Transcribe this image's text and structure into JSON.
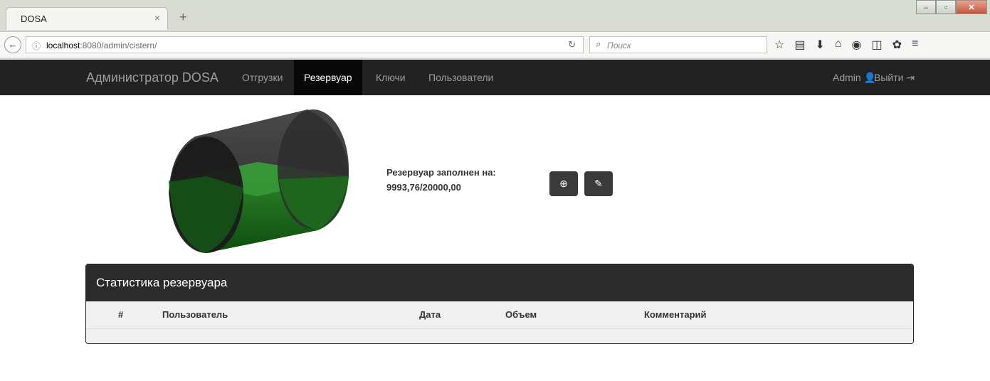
{
  "browser": {
    "tab_title": "DOSA",
    "tab_close": "×",
    "new_tab": "+",
    "url_host": "localhost",
    "url_rest": ":8080/admin/cistern/",
    "search_placeholder": "Поиск",
    "icons": [
      "star-icon",
      "reading-list-icon",
      "download-icon",
      "home-icon",
      "chat-icon",
      "pocket-icon",
      "extension-icon",
      "menu-icon"
    ]
  },
  "nav": {
    "brand": "Администратор DOSA",
    "items": [
      {
        "label": "Отгрузки",
        "active": false
      },
      {
        "label": "Резервуар",
        "active": true
      },
      {
        "label": "Ключи",
        "active": false
      },
      {
        "label": "Пользователи",
        "active": false
      }
    ],
    "user": "Admin",
    "logout": "Выйти"
  },
  "cistern": {
    "fill_label": "Резервуар заполнен на:",
    "fill_value": "9993,76/20000,00",
    "fill_fraction": 0.4997,
    "colors": {
      "liquid": "#1f6b1f",
      "tank": "#2a2a2a"
    }
  },
  "stats": {
    "title": "Статистика резервуара",
    "columns": [
      "#",
      "Пользователь",
      "Дата",
      "Объем",
      "Комментарий"
    ],
    "rows": []
  }
}
